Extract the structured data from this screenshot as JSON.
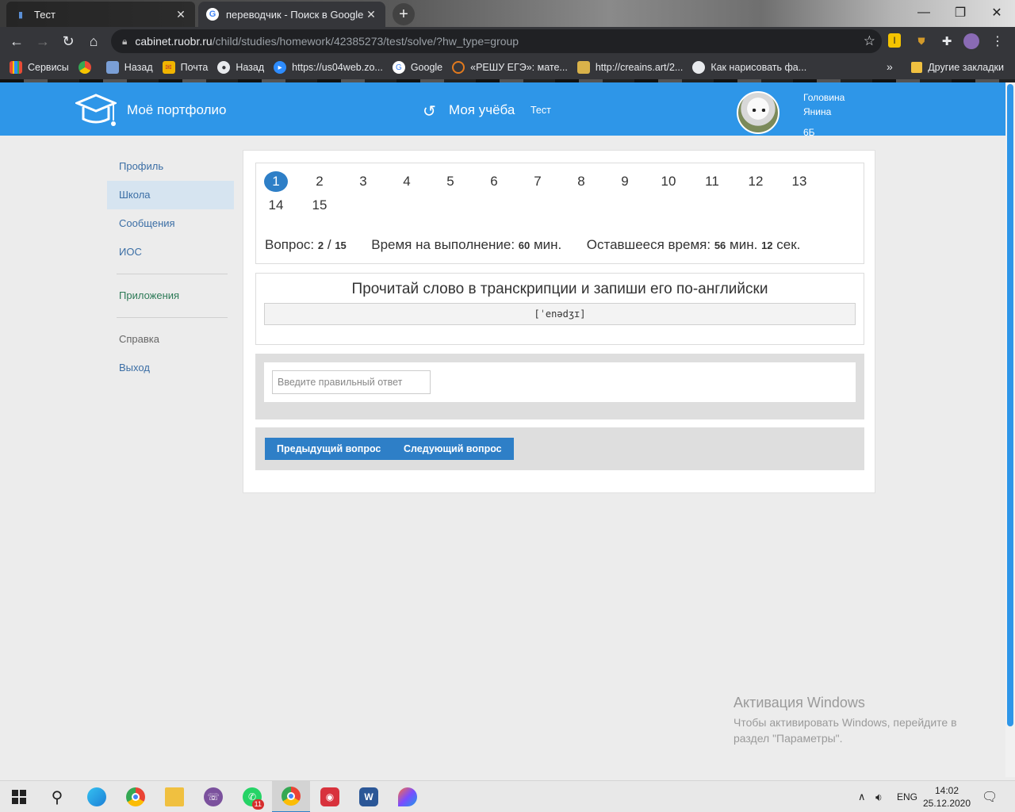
{
  "browser": {
    "tabs": [
      {
        "title": "Тест",
        "active": false
      },
      {
        "title": "переводчик - Поиск в Google",
        "active": true
      }
    ],
    "url_host": "cabinet.ruobr.ru",
    "url_path": "/child/studies/homework/42385273/test/solve/?hw_type=group",
    "bookmarks": [
      {
        "label": "Сервисы",
        "icon": "apps-grid-icon",
        "color": "#e8a33a"
      },
      {
        "label": "",
        "icon": "colorful-circle-icon",
        "color": "#e94b35"
      },
      {
        "label": "Назад",
        "icon": "photo-icon",
        "color": "#7a9fd6"
      },
      {
        "label": "Почта",
        "icon": "mail-icon",
        "color": "#f0b400"
      },
      {
        "label": "Назад",
        "icon": "globe-icon",
        "color": "#e8eaed"
      },
      {
        "label": "https://us04web.zo...",
        "icon": "zoom-icon",
        "color": "#2d8cff"
      },
      {
        "label": "Google",
        "icon": "google-icon",
        "color": "#4285f4"
      },
      {
        "label": "«РЕШУ ЕГЭ»: мате...",
        "icon": "reshu-ege-icon",
        "color": "#e27a1e"
      },
      {
        "label": "http://creains.art/2...",
        "icon": "art-icon",
        "color": "#d9b24a"
      },
      {
        "label": "Как нарисовать фа...",
        "icon": "globe-icon",
        "color": "#e8eaed"
      }
    ],
    "other_bookmarks": "Другие закладки"
  },
  "header": {
    "site_title": "Моё портфолио",
    "section_title": "Моя учёба",
    "crumb": "Тест",
    "user_lastname": "Головина",
    "user_firstname": "Янина",
    "user_class": "6Б",
    "accent": "#2e96e8"
  },
  "sidebar": {
    "items": [
      {
        "label": "Профиль"
      },
      {
        "label": "Школа"
      },
      {
        "label": "Сообщения"
      },
      {
        "label": "ИОС"
      },
      {
        "label": "Приложения"
      },
      {
        "label": "Справка"
      },
      {
        "label": "Выход"
      }
    ]
  },
  "test": {
    "questions": [
      "1",
      "2",
      "3",
      "4",
      "5",
      "6",
      "7",
      "8",
      "9",
      "10",
      "11",
      "12",
      "13",
      "14",
      "15"
    ],
    "current_question": "1",
    "question_label": "Вопрос:",
    "question_current": "2",
    "question_sep": "/",
    "question_total": "15",
    "time_label": "Время на выполнение:",
    "time_value": "60",
    "min_label": "мин.",
    "remaining_label": "Оставшееся время:",
    "remaining_min": "56",
    "remaining_sec": "12",
    "sec_label": "сек.",
    "question_text": "Прочитай слово в транскрипции и запиши его по-английски",
    "transcription": "[ˈenədʒɪ]",
    "answer_placeholder": "Введите правильный ответ",
    "prev_button": "Предыдущий вопрос",
    "next_button": "Следующий вопрос"
  },
  "watermark": {
    "title": "Активация Windows",
    "subtitle": "Чтобы активировать Windows, перейдите в раздел \"Параметры\"."
  },
  "taskbar": {
    "lang": "ENG",
    "time": "14:02",
    "date": "25.12.2020",
    "whatsapp_badge": "11"
  }
}
